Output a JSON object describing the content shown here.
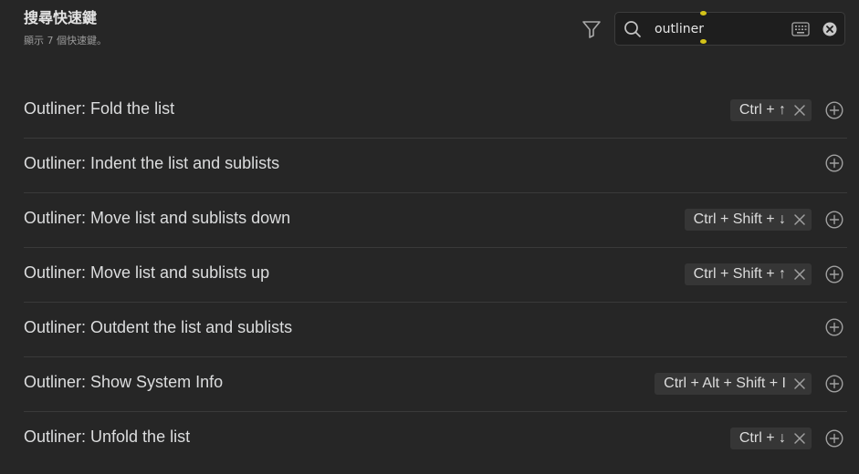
{
  "header": {
    "title": "搜尋快速鍵",
    "subtitle": "顯示 7 個快速鍵。"
  },
  "search": {
    "value": "outliner",
    "accent_color": "#d4c319"
  },
  "icons": {
    "filter": "filter-icon",
    "search": "search-icon",
    "keyboard": "keyboard-icon",
    "clear": "clear-icon",
    "add": "plus-circle-icon",
    "remove": "close-icon"
  },
  "commands": [
    {
      "label": "Outliner: Fold the list",
      "hotkey": "Ctrl + ↑"
    },
    {
      "label": "Outliner: Indent the list and sublists",
      "hotkey": ""
    },
    {
      "label": "Outliner: Move list and sublists down",
      "hotkey": "Ctrl + Shift + ↓"
    },
    {
      "label": "Outliner: Move list and sublists up",
      "hotkey": "Ctrl + Shift + ↑"
    },
    {
      "label": "Outliner: Outdent the list and sublists",
      "hotkey": ""
    },
    {
      "label": "Outliner: Show System Info",
      "hotkey": "Ctrl + Alt + Shift + I"
    },
    {
      "label": "Outliner: Unfold the list",
      "hotkey": "Ctrl + ↓"
    }
  ]
}
